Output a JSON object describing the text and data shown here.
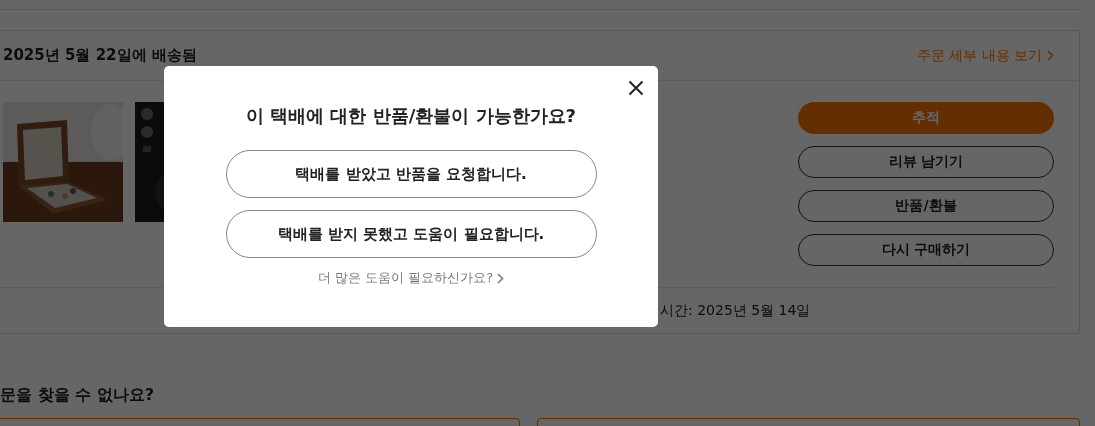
{
  "order": {
    "status": "2025년 5월 22일에 배송됨",
    "details_link": "주문 세부 내용 보기",
    "actions": [
      {
        "label": "추적",
        "kind": "primary"
      },
      {
        "label": "리뷰 남기기",
        "kind": "outline"
      },
      {
        "label": "반품/환불",
        "kind": "outline"
      },
      {
        "label": "다시 구매하기",
        "kind": "outline"
      }
    ],
    "footer_text": "시간: 2025년 5월 14일"
  },
  "help": {
    "title": "문을 찾을 수 없나요?"
  },
  "modal": {
    "title": "이 택배에 대한 반품/환불이 가능한가요?",
    "options": [
      "택배를 받았고 반품을 요청합니다.",
      "택배를 받지 못했고 도움이 필요합니다."
    ],
    "more_help": "더 많은 도움이 필요하신가요?"
  }
}
